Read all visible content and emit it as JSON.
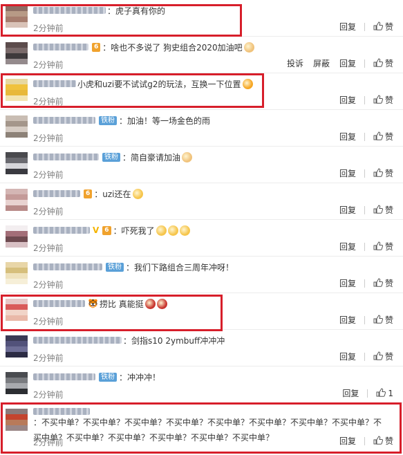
{
  "labels": {
    "reply": "回复",
    "report": "投诉",
    "block": "屏蔽",
    "like": "赞"
  },
  "comments": [
    {
      "text": "：虎子真有你的",
      "time": "2分钟前",
      "avatar": [
        "#8c6e64",
        "#b79a86",
        "#a67d6e",
        "#d9c3b8"
      ],
      "uname_w": 105,
      "badges": []
    },
    {
      "text": "：啥也不多说了 狗史组合2020加油吧",
      "time": "2分钟前",
      "avatar": [
        "#5c4c4c",
        "#7a6a6a",
        "#3f3a3c",
        "#948a8c"
      ],
      "uname_w": 80,
      "badges": [
        "gold"
      ],
      "emoji": [
        "#f0c27a"
      ],
      "extra_actions": true
    },
    {
      "text": "小虎和uzi要不试试g2的玩法，互换一下位置",
      "time": "2分钟前",
      "avatar": [
        "#e7d8a0",
        "#f0c23d",
        "#e8b83a",
        "#f3e4b0"
      ],
      "uname_w": 62,
      "badges": [],
      "emoji": [
        "#f6a623"
      ]
    },
    {
      "text": "：加油！等一场金色的雨",
      "time": "2分钟前",
      "avatar": [
        "#c9bdb3",
        "#a4968b",
        "#d6ccc4",
        "#8d8278"
      ],
      "uname_w": 90,
      "badges": [
        "fan"
      ]
    },
    {
      "text": "：简自豪请加油",
      "time": "2分钟前",
      "avatar": [
        "#4a4a4e",
        "#6a6a70",
        "#d6d6da",
        "#3a3a40"
      ],
      "uname_w": 95,
      "badges": [
        "fan"
      ],
      "emoji": [
        "#f0c27a"
      ]
    },
    {
      "text": "：uzi还在",
      "time": "2分钟前",
      "avatar": [
        "#d4b6b4",
        "#c49a98",
        "#e8d2d0",
        "#b88a88"
      ],
      "uname_w": 68,
      "badges": [
        "gold"
      ],
      "emoji": [
        "#f6c54a"
      ]
    },
    {
      "text": "：吓死我了",
      "time": "2分钟前",
      "avatar": [
        "#f3eef0",
        "#a36e78",
        "#6e4a50",
        "#d8c0c4"
      ],
      "uname_w": 82,
      "badges": [
        "v",
        "gold"
      ],
      "emoji": [
        "#f6c54a",
        "#f6c54a",
        "#f6c54a"
      ]
    },
    {
      "text": "：我们下路组合三周年冲呀！",
      "time": "2分钟前",
      "avatar": [
        "#e8d6a8",
        "#d6bf7c",
        "#efe2bc",
        "#f6efd8"
      ],
      "uname_w": 100,
      "badges": [
        "fan"
      ]
    },
    {
      "text": "捞比 真能挺",
      "time": "2分钟前",
      "avatar": [
        "#e7c6c6",
        "#d95a5a",
        "#f1d4c8",
        "#e9b8a8"
      ],
      "uname_w": 75,
      "badges": [
        "tiger"
      ],
      "emoji": [
        "#c8352f",
        "#c8352f"
      ]
    },
    {
      "text": "：剑指s10 2ymbuff冲冲冲",
      "time": "2分钟前",
      "avatar": [
        "#3a3a55",
        "#52527a",
        "#6e6e96",
        "#2c2c44"
      ],
      "uname_w": 128,
      "badges": []
    },
    {
      "text": "：冲冲冲！",
      "time": "2分钟前",
      "avatar": [
        "#4a4c50",
        "#7a7c80",
        "#a8aaae",
        "#2c2e32"
      ],
      "uname_w": 90,
      "badges": [
        "fan"
      ],
      "like_count": "1"
    },
    {
      "text": "：不买中单？不买中单？不买中单？不买中单？不买中单？不买中单？不买中单？不买中单？不买中单？不买中单？不买中单？不买中单？不买中单？不买中单？",
      "time": "2分钟前",
      "avatar": [
        "#8a7a7a",
        "#c4442e",
        "#b87a5a",
        "#9a8686"
      ],
      "uname_w": 82,
      "badges": []
    }
  ],
  "badge_labels": {
    "fan": "铁粉",
    "gold": "6",
    "tiger": "🐯"
  }
}
